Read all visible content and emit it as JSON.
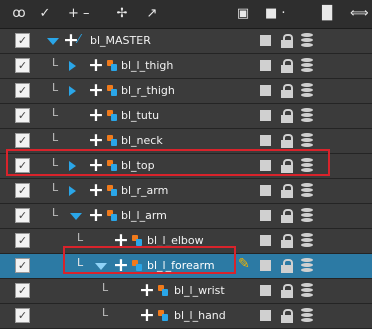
{
  "toolbar": {
    "icons": [
      "onion-skin-icon",
      "enable-icon",
      "add-remove-icon",
      "add-peg-icon",
      "add-layer-icon",
      "render-preview-icon",
      "show-icon",
      "show-alt-icon",
      "collapse-icon"
    ],
    "glyphs": [
      "ꝏ",
      "✓",
      "+ –",
      "✢",
      "↗",
      "▣",
      "■ ·",
      "█",
      "⟺"
    ]
  },
  "layers": [
    {
      "name": "bl_MASTER",
      "checked": true,
      "expander": "down",
      "type": "layer-icon"
    },
    {
      "name": "bl_l_thigh",
      "checked": true,
      "expander": "right",
      "type": "peg"
    },
    {
      "name": "bl_r_thigh",
      "checked": true,
      "expander": "right",
      "type": "peg"
    },
    {
      "name": "bl_tutu",
      "checked": true,
      "expander": "",
      "type": "peg"
    },
    {
      "name": "bl_neck",
      "checked": true,
      "expander": "",
      "type": "peg"
    },
    {
      "name": "bl_top",
      "checked": true,
      "expander": "right",
      "type": "peg"
    },
    {
      "name": "bl_r_arm",
      "checked": true,
      "expander": "right",
      "type": "peg"
    },
    {
      "name": "bl_l_arm",
      "checked": true,
      "expander": "down",
      "type": "peg"
    },
    {
      "name": "bl_l_elbow",
      "checked": true,
      "expander": "",
      "type": "peg"
    },
    {
      "name": "bl_l_forearm",
      "checked": true,
      "expander": "down",
      "type": "peg",
      "selected": true
    },
    {
      "name": "bl_l_wrist",
      "checked": true,
      "expander": "",
      "type": "peg"
    },
    {
      "name": "bl_l_hand",
      "checked": true,
      "expander": "",
      "type": "peg"
    }
  ],
  "colors": {
    "selection": "#2c7aa4",
    "highlight": "#d9232b",
    "expander": "#2aa6e8"
  }
}
